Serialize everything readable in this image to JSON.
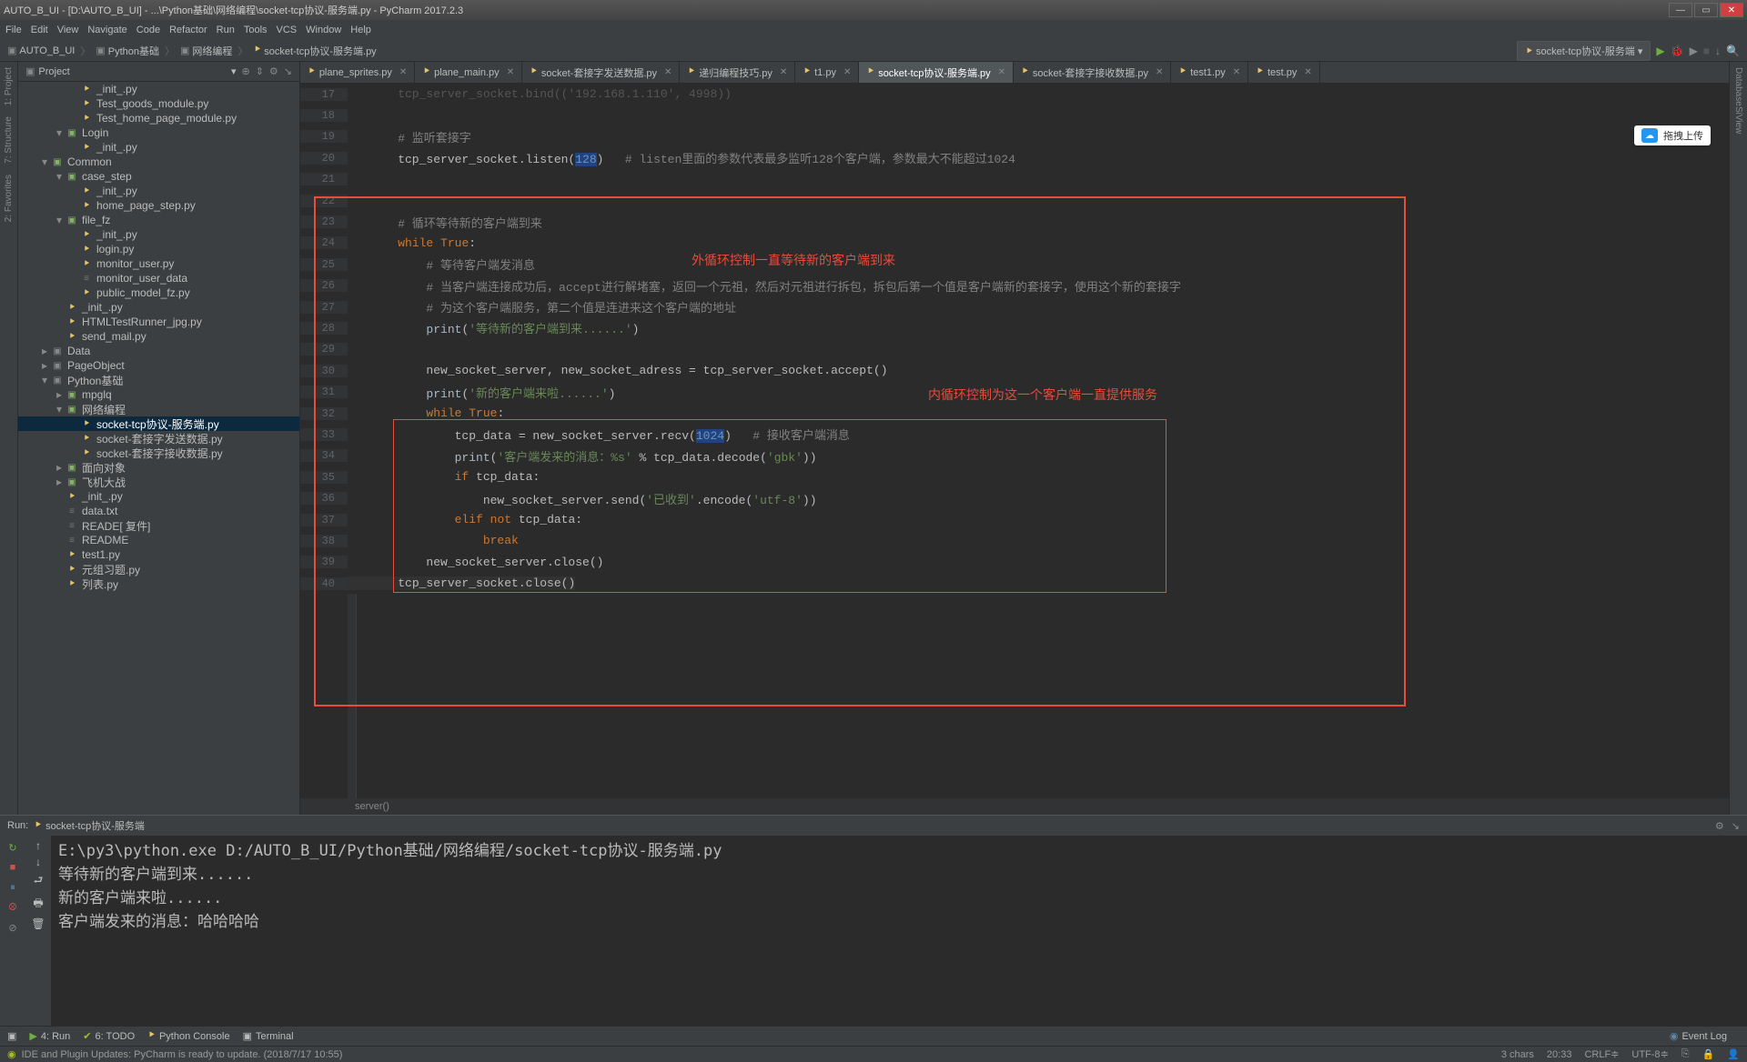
{
  "title": "AUTO_B_UI - [D:\\AUTO_B_UI] - ...\\Python基础\\网络编程\\socket-tcp协议-服务端.py - PyCharm 2017.2.3",
  "menu": [
    "File",
    "Edit",
    "View",
    "Navigate",
    "Code",
    "Refactor",
    "Run",
    "Tools",
    "VCS",
    "Window",
    "Help"
  ],
  "breadcrumbs": [
    "AUTO_B_UI",
    "Python基础",
    "网络编程",
    "socket-tcp协议-服务端.py"
  ],
  "run_config": "socket-tcp协议-服务端",
  "project_panel": {
    "title": "Project"
  },
  "left_tabs": [
    "1: Project",
    "7: Structure",
    "2: Favorites"
  ],
  "right_tabs": [
    "Database",
    "SiView"
  ],
  "tree": [
    {
      "d": 3,
      "t": "file",
      "n": "_init_.py"
    },
    {
      "d": 3,
      "t": "file",
      "n": "Test_goods_module.py"
    },
    {
      "d": 3,
      "t": "file",
      "n": "Test_home_page_module.py"
    },
    {
      "d": 2,
      "t": "pkg",
      "a": "down",
      "n": "Login"
    },
    {
      "d": 3,
      "t": "file",
      "n": "_init_.py"
    },
    {
      "d": 1,
      "t": "pkg",
      "a": "down",
      "n": "Common"
    },
    {
      "d": 2,
      "t": "pkg",
      "a": "down",
      "n": "case_step"
    },
    {
      "d": 3,
      "t": "file",
      "n": "_init_.py"
    },
    {
      "d": 3,
      "t": "file",
      "n": "home_page_step.py"
    },
    {
      "d": 2,
      "t": "pkg",
      "a": "down",
      "n": "file_fz"
    },
    {
      "d": 3,
      "t": "file",
      "n": "_init_.py"
    },
    {
      "d": 3,
      "t": "file",
      "n": "login.py"
    },
    {
      "d": 3,
      "t": "file",
      "n": "monitor_user.py"
    },
    {
      "d": 3,
      "t": "txt",
      "n": "monitor_user_data"
    },
    {
      "d": 3,
      "t": "file",
      "n": "public_model_fz.py"
    },
    {
      "d": 2,
      "t": "file",
      "n": "_init_.py"
    },
    {
      "d": 2,
      "t": "file",
      "n": "HTMLTestRunner_jpg.py"
    },
    {
      "d": 2,
      "t": "file",
      "n": "send_mail.py"
    },
    {
      "d": 1,
      "t": "folder",
      "a": "right",
      "n": "Data"
    },
    {
      "d": 1,
      "t": "folder",
      "a": "right",
      "n": "PageObject"
    },
    {
      "d": 1,
      "t": "folder",
      "a": "down",
      "n": "Python基础"
    },
    {
      "d": 2,
      "t": "pkg",
      "a": "right",
      "n": "mpglq"
    },
    {
      "d": 2,
      "t": "pkg",
      "a": "down",
      "n": "网络编程"
    },
    {
      "d": 3,
      "t": "file",
      "n": "socket-tcp协议-服务端.py",
      "sel": true
    },
    {
      "d": 3,
      "t": "file",
      "n": "socket-套接字发送数据.py"
    },
    {
      "d": 3,
      "t": "file",
      "n": "socket-套接字接收数据.py"
    },
    {
      "d": 2,
      "t": "pkg",
      "a": "right",
      "n": "面向对象"
    },
    {
      "d": 2,
      "t": "pkg",
      "a": "right",
      "n": "飞机大战"
    },
    {
      "d": 2,
      "t": "file",
      "n": "_init_.py"
    },
    {
      "d": 2,
      "t": "txt",
      "n": "data.txt"
    },
    {
      "d": 2,
      "t": "txt",
      "n": "READE[ 复件]"
    },
    {
      "d": 2,
      "t": "txt",
      "n": "README"
    },
    {
      "d": 2,
      "t": "file",
      "n": "test1.py"
    },
    {
      "d": 2,
      "t": "file",
      "n": "元组习题.py"
    },
    {
      "d": 2,
      "t": "file",
      "n": "列表.py"
    }
  ],
  "tabs": [
    {
      "n": "plane_sprites.py"
    },
    {
      "n": "plane_main.py"
    },
    {
      "n": "socket-套接字发送数据.py"
    },
    {
      "n": "递归编程技巧.py"
    },
    {
      "n": "t1.py"
    },
    {
      "n": "socket-tcp协议-服务端.py",
      "a": true
    },
    {
      "n": "socket-套接字接收数据.py"
    },
    {
      "n": "test1.py"
    },
    {
      "n": "test.py"
    }
  ],
  "code": {
    "start": 17,
    "lines": [
      {
        "raw": "    tcp_server_socket.bind(('192.168.1.110', 4998))",
        "dim": true
      },
      {
        "raw": ""
      },
      {
        "raw": "    # 监听套接字",
        "c": true
      },
      {
        "raw": "    tcp_server_socket.listen(|128|)   # listen里面的参数代表最多监听128个客户端，参数最大不能超过1024",
        "cmix": true
      },
      {
        "raw": ""
      },
      {
        "raw": ""
      },
      {
        "raw": "    # 循环等待新的客户端到来",
        "c": true
      },
      {
        "raw": "    ~while~ ~True~:"
      },
      {
        "raw": "        # 等待客户端发消息",
        "c": true
      },
      {
        "raw": "        # 当客户端连接成功后，accept进行解堵塞，返回一个元祖，然后对元祖进行拆包，拆包后第一个值是客户端新的套接字，使用这个新的套接字",
        "c": true
      },
      {
        "raw": "        # 为这个客户端服务，第二个值是连进来这个客户端的地址",
        "c": true
      },
      {
        "raw": "        print(^'等待新的客户端到来......'^)"
      },
      {
        "raw": ""
      },
      {
        "raw": "        new_socket_server, new_socket_adress = tcp_server_socket.accept()"
      },
      {
        "raw": "        print(^'新的客户端来啦......'^)"
      },
      {
        "raw": "        ~while~ ~True~:"
      },
      {
        "raw": "            tcp_data = new_socket_server.recv(|1024|)   # 接收客户端消息",
        "cmix": true
      },
      {
        "raw": "            print(^'客户端发来的消息：%s'^ % tcp_data.decode(^'gbk'^))"
      },
      {
        "raw": "            ~if~ tcp_data:"
      },
      {
        "raw": "                new_socket_server.send(^'已收到'^.encode(^'utf-8'^))"
      },
      {
        "raw": "            ~elif~ ~not~ tcp_data:"
      },
      {
        "raw": "                ~break~"
      },
      {
        "raw": "        new_socket_server.close()"
      },
      {
        "raw": "    `tcp_server_socket.close()`",
        "hl": true
      }
    ]
  },
  "breadcrumb2": "server()",
  "anno1": "外循环控制一直等待新的客户端到来",
  "anno2": "内循环控制为这一个客户端一直提供服务",
  "run": {
    "label": "Run:",
    "config": "socket-tcp协议-服务端",
    "out": [
      "E:\\py3\\python.exe D:/AUTO_B_UI/Python基础/网络编程/socket-tcp协议-服务端.py",
      "等待新的客户端到来......",
      "新的客户端来啦......",
      "客户端发来的消息：哈哈哈哈"
    ]
  },
  "bottom": {
    "run": "4: Run",
    "todo": "6: TODO",
    "pyconsole": "Python Console",
    "terminal": "Terminal",
    "eventlog": "Event Log"
  },
  "status": {
    "msg": "IDE and Plugin Updates: PyCharm is ready to update. (2018/7/17 10:55)",
    "chars": "3 chars",
    "pos": "20:33",
    "crlf": "CRLF",
    "enc": "UTF-8",
    "ctx": "⎘"
  },
  "toast": "拖拽上传"
}
